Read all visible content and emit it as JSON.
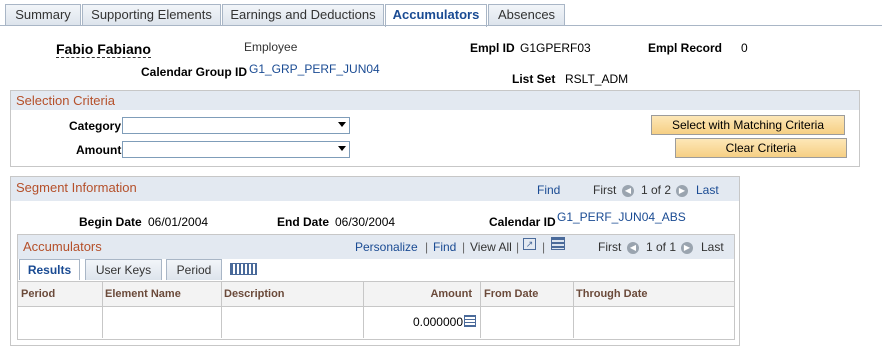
{
  "tabs": [
    {
      "label": "Summary"
    },
    {
      "label": "Supporting Elements"
    },
    {
      "label": "Earnings and Deductions"
    },
    {
      "label": "Accumulators"
    },
    {
      "label": "Absences"
    }
  ],
  "header": {
    "name": "Fabio Fabiano",
    "employee_label": "Employee",
    "emplid_label": "Empl ID",
    "emplid_value": "G1GPERF03",
    "emplrec_label": "Empl Record",
    "emplrec_value": "0",
    "calgroup_label": "Calendar Group ID",
    "calgroup_value": "G1_GRP_PERF_JUN04",
    "listset_label": "List Set",
    "listset_value": "RSLT_ADM"
  },
  "selection": {
    "title": "Selection Criteria",
    "category_label": "Category",
    "category_value": "",
    "amount_label": "Amount",
    "amount_value": "",
    "select_button": "Select with Matching Criteria",
    "clear_button": "Clear Criteria"
  },
  "segment": {
    "title": "Segment Information",
    "find": "Find",
    "first": "First",
    "pager": "1 of 2",
    "last": "Last",
    "begin_label": "Begin Date",
    "begin_value": "06/01/2004",
    "end_label": "End Date",
    "end_value": "06/30/2004",
    "calendar_label": "Calendar ID",
    "calendar_value": "G1_PERF_JUN04_ABS"
  },
  "accumulators": {
    "title": "Accumulators",
    "personalize": "Personalize",
    "find": "Find",
    "view_all": "View All",
    "first": "First",
    "pager": "1 of 1",
    "last": "Last",
    "subtabs": [
      {
        "label": "Results"
      },
      {
        "label": "User Keys"
      },
      {
        "label": "Period"
      }
    ],
    "columns": [
      "Period",
      "Element Name",
      "Description",
      "Amount",
      "From Date",
      "Through Date"
    ],
    "rows": [
      {
        "period": "",
        "element": "",
        "description": "",
        "amount": "0.000000",
        "from": "",
        "through": ""
      }
    ]
  },
  "colors": {
    "link": "#1a4b93",
    "section_title": "#b5502a",
    "header_bg": "#e3e9f1"
  }
}
